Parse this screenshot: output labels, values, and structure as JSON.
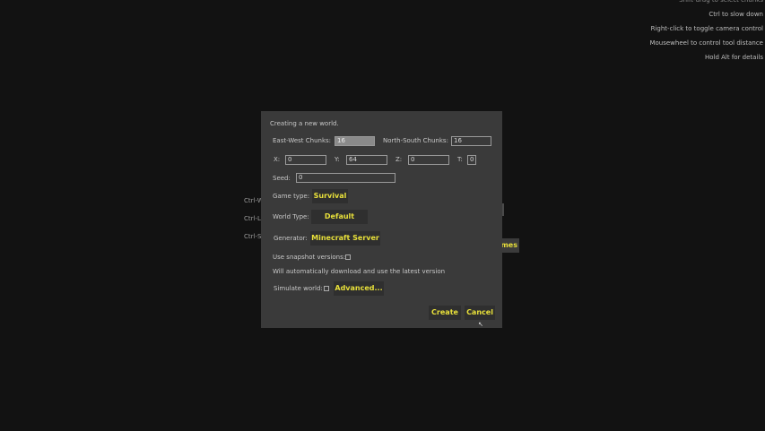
{
  "hints": {
    "clipped": "Shift-drag to select chunks",
    "slow": "Ctrl to slow down",
    "rightclick": "Right-click to toggle camera control",
    "mousewheel": "Mousewheel to control tool distance",
    "alt": "Hold Alt for details"
  },
  "background": {
    "label1": "Ctrl-W",
    "label2": "Ctrl-L",
    "label3": "Ctrl-S",
    "button": "mes"
  },
  "dialog": {
    "title": "Creating a new world.",
    "ew_label": "East-West Chunks:",
    "ew_value": "16",
    "ns_label": "North-South Chunks:",
    "ns_value": "16",
    "x_label": "X:",
    "x_value": "0",
    "y_label": "Y:",
    "y_value": "64",
    "z_label": "Z:",
    "z_value": "0",
    "t_label": "T:",
    "t_value": "0",
    "seed_label": "Seed:",
    "seed_value": "0",
    "gametype_label": "Game type:",
    "gametype_value": "Survival",
    "worldtype_label": "World Type:",
    "worldtype_value": "Default",
    "generator_label": "Generator:",
    "generator_value": "Minecraft Server",
    "snapshot_label": "Use snapshot versions:",
    "autodownload_text": "Will automatically download and use the latest version",
    "simulate_label": "Simulate world:",
    "advanced_label": "Advanced...",
    "create_label": "Create",
    "cancel_label": "Cancel"
  }
}
